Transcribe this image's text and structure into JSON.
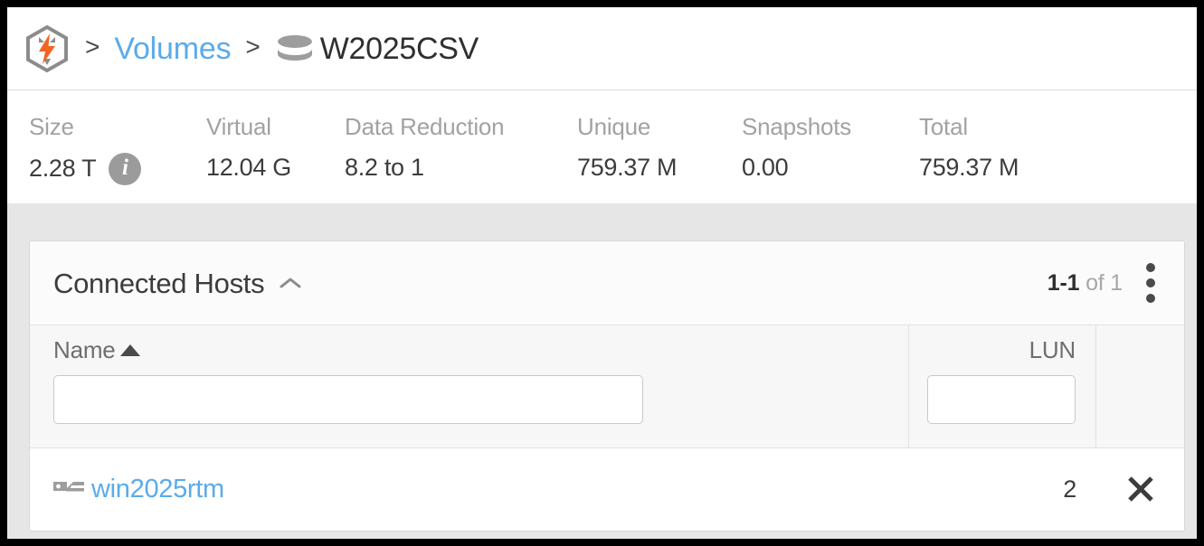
{
  "breadcrumb": {
    "logo_icon": "pure-storage-hexagon-bolt-logo",
    "separator": ">",
    "volumes_label": "Volumes",
    "volume_icon": "volume-cylinder-icon",
    "current_label": "W2025CSV"
  },
  "stats": [
    {
      "label": "Size",
      "value": "2.28 T",
      "info_icon": "info-icon"
    },
    {
      "label": "Virtual",
      "value": "12.04 G"
    },
    {
      "label": "Data Reduction",
      "value": "8.2 to 1"
    },
    {
      "label": "Unique",
      "value": "759.37 M"
    },
    {
      "label": "Snapshots",
      "value": "0.00"
    },
    {
      "label": "Total",
      "value": "759.37 M"
    }
  ],
  "panel": {
    "title": "Connected Hosts",
    "collapse_icon": "chevron-up-icon",
    "pager_range": "1-1",
    "pager_total": "of 1",
    "menu_icon": "kebab-menu-icon"
  },
  "table": {
    "columns": {
      "name": {
        "label": "Name",
        "sort_icon": "sort-ascending-icon",
        "filter_value": "",
        "filter_placeholder": ""
      },
      "lun": {
        "label": "LUN",
        "filter_value": "",
        "filter_placeholder": ""
      }
    },
    "rows": [
      {
        "icon": "host-icon",
        "name": "win2025rtm",
        "lun": "2",
        "remove_icon": "close-x-icon"
      }
    ]
  },
  "colors": {
    "link_blue": "#5aabea",
    "logo_orange": "#f26422",
    "logo_gray": "#8c8c8c",
    "text_dark": "#3c3c3c",
    "text_muted": "#a2a2a2",
    "panel_bg": "#fbfbfb",
    "page_bg": "#e6e6e6"
  }
}
